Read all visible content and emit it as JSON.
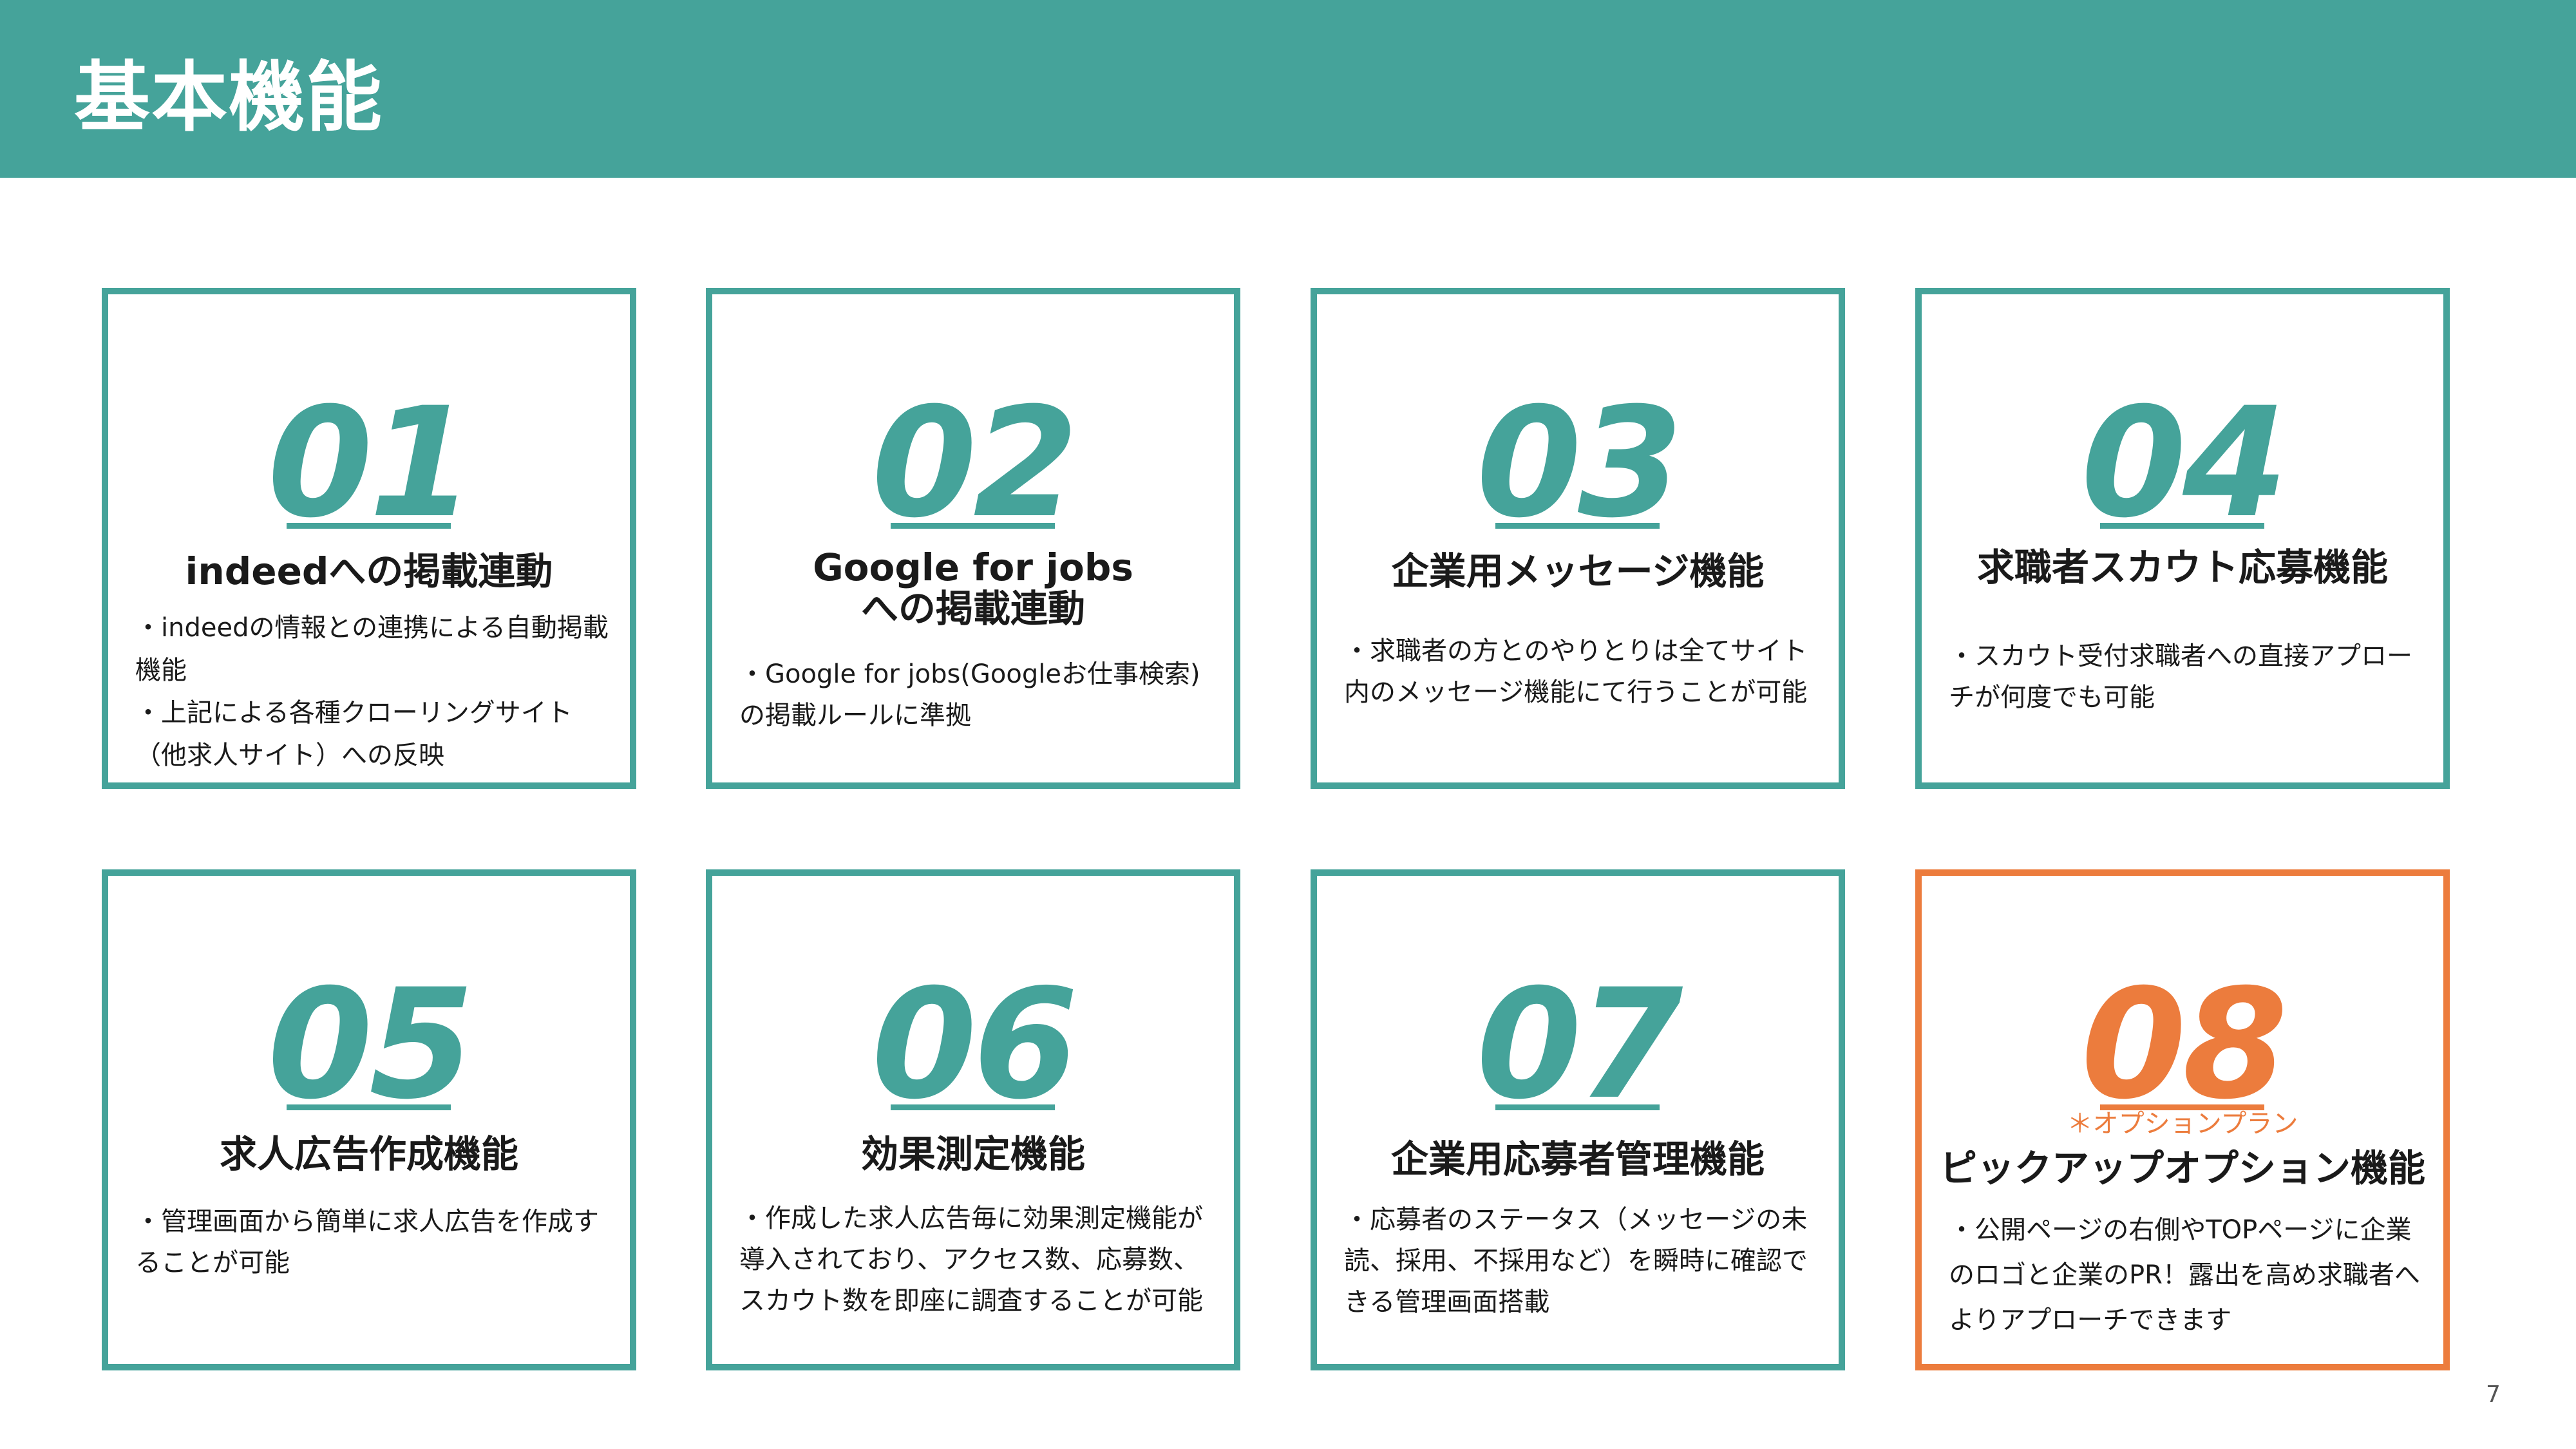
{
  "header": {
    "title": "基本機能"
  },
  "page_number": "7",
  "colors": {
    "teal": "#45a39a",
    "orange": "#ec7c3d",
    "text": "#1a1a1a"
  },
  "cards": [
    {
      "num": "01",
      "title_lines": [
        "indeedへの掲載連動"
      ],
      "desc": [
        "・indeedの情報との連携による自動掲載機能",
        "・上記による各種クローリングサイト（他求人サイト）への反映"
      ]
    },
    {
      "num": "02",
      "title_lines": [
        "Google for jobs",
        "への掲載連動"
      ],
      "desc": [
        "・Google for jobs(Googleお仕事検索)の掲載ルールに準拠"
      ]
    },
    {
      "num": "03",
      "title_lines": [
        "企業用メッセージ機能"
      ],
      "desc": [
        "・求職者の方とのやりとりは全てサイト内のメッセージ機能にて行うことが可能"
      ]
    },
    {
      "num": "04",
      "title_lines": [
        "求職者スカウト応募機能"
      ],
      "desc": [
        "・スカウト受付求職者への直接アプローチが何度でも可能"
      ]
    },
    {
      "num": "05",
      "title_lines": [
        "求人広告作成機能"
      ],
      "desc": [
        "・管理画面から簡単に求人広告を作成することが可能"
      ]
    },
    {
      "num": "06",
      "title_lines": [
        "効果測定機能"
      ],
      "desc": [
        "・作成した求人広告毎に効果測定機能が導入されており、アクセス数、応募数、スカウト数を即座に調査することが可能"
      ]
    },
    {
      "num": "07",
      "title_lines": [
        "企業用応募者管理機能"
      ],
      "desc": [
        "・応募者のステータス（メッセージの未読、採用、不採用など）を瞬時に確認できる管理画面搭載"
      ]
    },
    {
      "num": "08",
      "note": "＊オプションプラン",
      "title_lines": [
        "ピックアップオプション機能"
      ],
      "desc": [
        "・公開ページの右側やTOPページに企業のロゴと企業のPR！露出を高め求職者へよりアプローチできます"
      ]
    }
  ]
}
